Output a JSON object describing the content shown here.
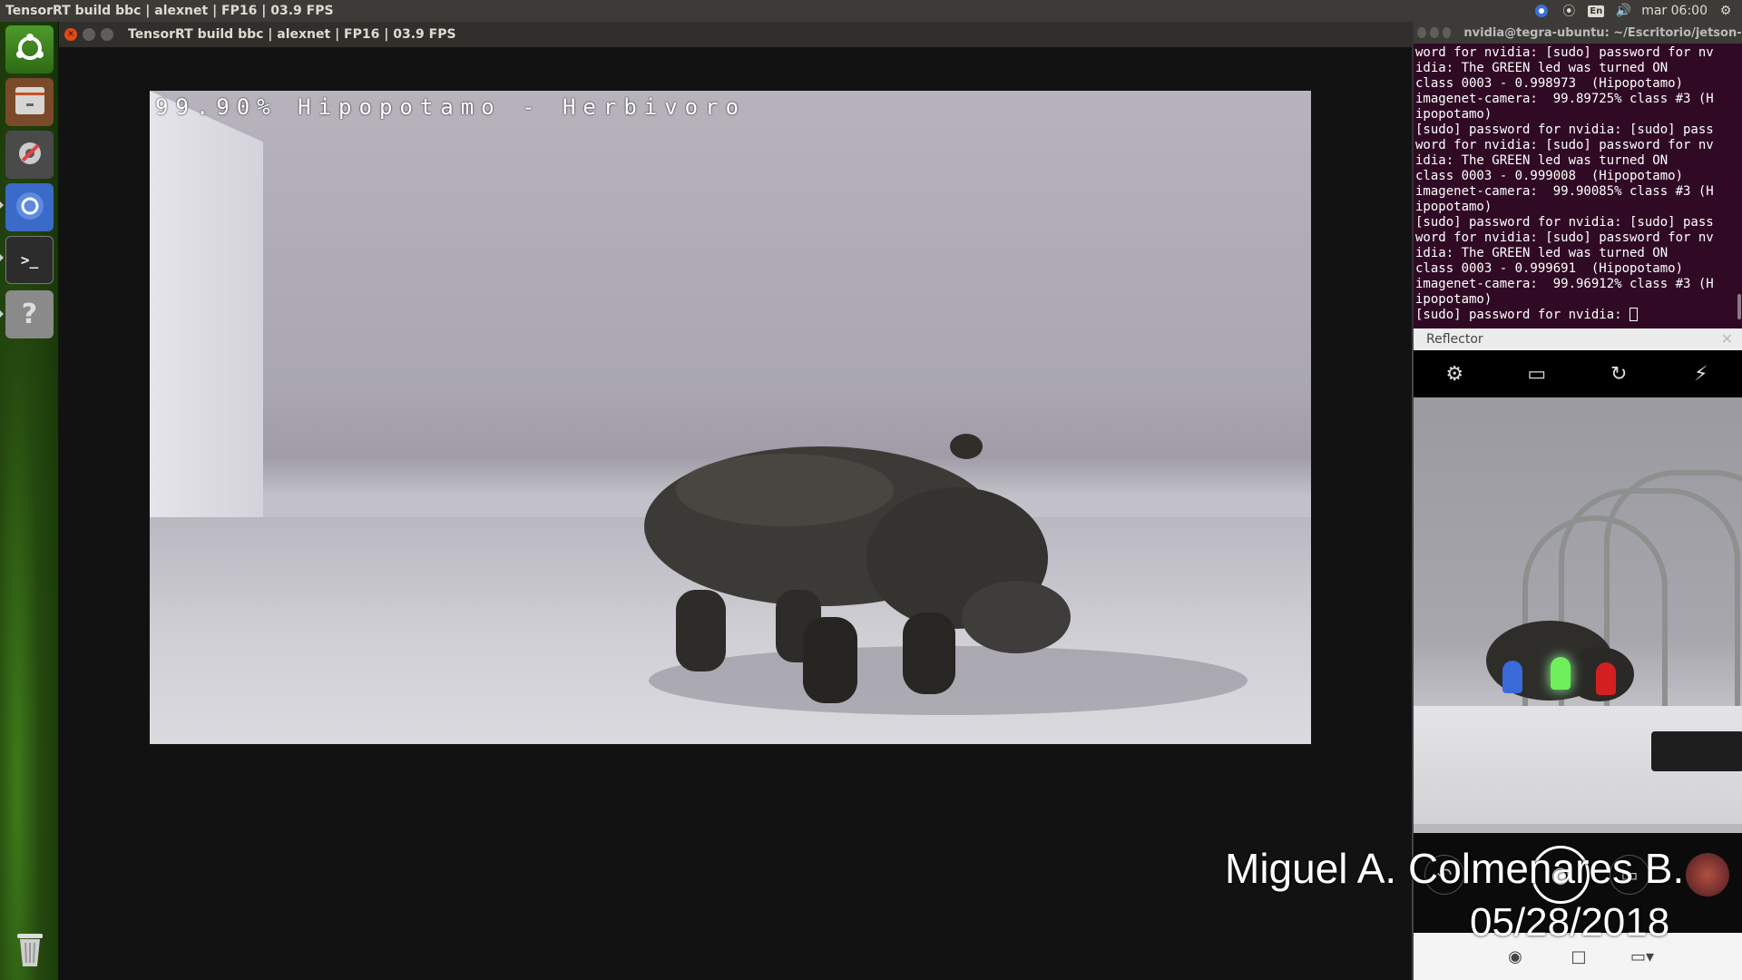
{
  "top_panel": {
    "title": "TensorRT build bbc | alexnet | FP16 | 03.9 FPS",
    "keyboard_lang": "En",
    "clock": "mar 06:00"
  },
  "launcher": {
    "items": [
      "ubuntu-dash",
      "files",
      "system-settings",
      "chromium",
      "terminal",
      "help"
    ],
    "trash": "trash"
  },
  "main_window": {
    "title": "TensorRT build bbc | alexnet | FP16 | 03.9 FPS",
    "overlay": "99.90% Hipopotamo - Herbivoro"
  },
  "watermark": {
    "author": "Miguel A. Colmenares B.",
    "date": "05/28/2018"
  },
  "terminal": {
    "title": "nvidia@tegra-ubuntu: ~/Escritorio/jetson-inference",
    "lines": [
      "word for nvidia: [sudo] password for nv",
      "idia: The GREEN led was turned ON",
      "class 0003 - 0.998973  (Hipopotamo)",
      "imagenet-camera:  99.89725% class #3 (H",
      "ipopotamo)",
      "[sudo] password for nvidia: [sudo] pass",
      "word for nvidia: [sudo] password for nv",
      "idia: The GREEN led was turned ON",
      "class 0003 - 0.999008  (Hipopotamo)",
      "imagenet-camera:  99.90085% class #3 (H",
      "ipopotamo)",
      "[sudo] password for nvidia: [sudo] pass",
      "word for nvidia: [sudo] password for nv",
      "idia: The GREEN led was turned ON",
      "class 0003 - 0.999691  (Hipopotamo)",
      "imagenet-camera:  99.96912% class #3 (H",
      "ipopotamo)"
    ],
    "prompt": "[sudo] password for nvidia: "
  },
  "reflector": {
    "title": "Reflector",
    "toolbar_icons": [
      "settings-icon",
      "flip-camera-icon",
      "camera-switch-icon",
      "flash-off-icon"
    ],
    "bottom_icons": [
      "photo-mode-icon",
      "crop-icon",
      "devices-icon"
    ]
  }
}
